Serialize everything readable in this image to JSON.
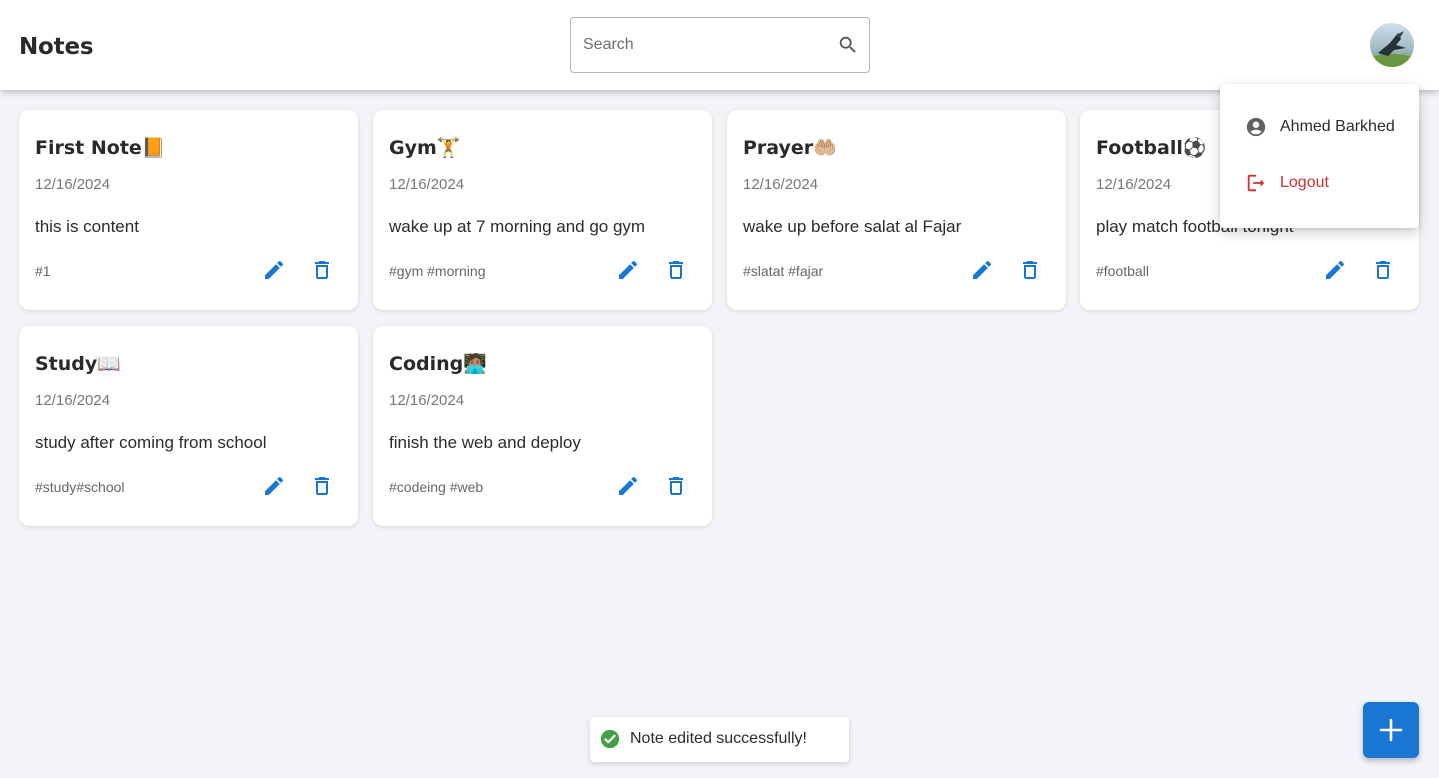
{
  "header": {
    "title": "Notes",
    "search_placeholder": "Search",
    "avatar_icon": "user-avatar-photo"
  },
  "user_menu": {
    "username": "Ahmed Barkhed",
    "logout_label": "Logout",
    "user_icon": "account-circle-icon",
    "logout_icon": "logout-icon",
    "logout_color": "#d32f2f"
  },
  "notes": [
    {
      "title": "First Note📙",
      "date": "12/16/2024",
      "content": "this is content",
      "tags": "#1"
    },
    {
      "title": "Gym🏋️",
      "date": "12/16/2024",
      "content": "wake up at 7 morning and go gym",
      "tags": "#gym #morning"
    },
    {
      "title": "Prayer🤲🏼",
      "date": "12/16/2024",
      "content": "wake up before salat al Fajar",
      "tags": "#slatat #fajar"
    },
    {
      "title": "Football⚽",
      "date": "12/16/2024",
      "content": "play match football tonight",
      "tags": "#football"
    },
    {
      "title": "Study📖",
      "date": "12/16/2024",
      "content": "study after coming from school",
      "tags": "#study#school"
    },
    {
      "title": "Coding🧑🏽‍💻",
      "date": "12/16/2024",
      "content": "finish the web and deploy",
      "tags": "#codeing #web"
    }
  ],
  "note_actions": {
    "edit_icon": "pencil-icon",
    "delete_icon": "trash-icon",
    "icon_color": "#1976d2"
  },
  "toast": {
    "message": "Note edited successfully!",
    "icon": "check-circle-icon",
    "icon_color": "#43a047"
  },
  "fab": {
    "icon": "plus-icon",
    "color": "#1976d2"
  }
}
